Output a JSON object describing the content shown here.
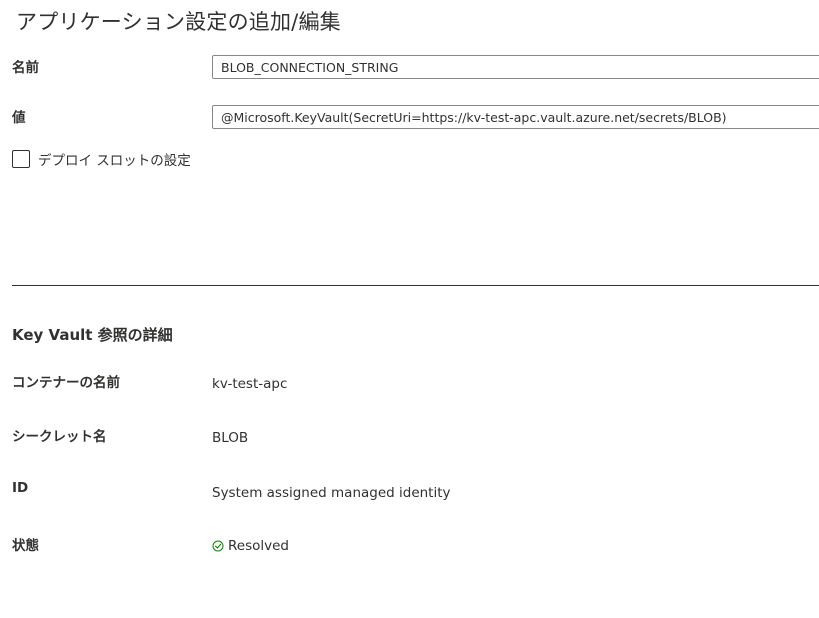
{
  "header": {
    "title": "アプリケーション設定の追加/編集"
  },
  "form": {
    "name_label": "名前",
    "name_value": "BLOB_CONNECTION_STRING",
    "value_label": "値",
    "value_value": "@Microsoft.KeyVault(SecretUri=https://kv-test-apc.vault.azure.net/secrets/BLOB)",
    "slot_checkbox_label": "デプロイ スロットの設定",
    "slot_checkbox_checked": false
  },
  "keyvault": {
    "section_title": "Key Vault 参照の詳細",
    "container_label": "コンテナーの名前",
    "container_value": "kv-test-apc",
    "secret_label": "シークレット名",
    "secret_value": "BLOB",
    "identity_label": "ID",
    "identity_value": "System assigned managed identity",
    "status_label": "状態",
    "status_value": "Resolved",
    "status_icon": "check-circle-icon",
    "status_color": "#107c10"
  }
}
